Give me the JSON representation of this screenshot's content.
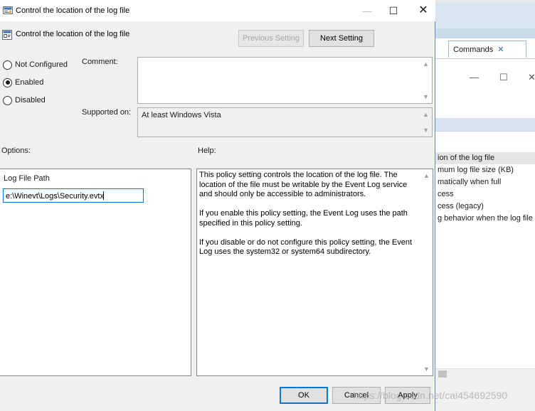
{
  "window": {
    "title": "Control the location of the log file",
    "minimize_glyph": "—",
    "maximize_glyph": "☐",
    "close_glyph": "✕"
  },
  "header": {
    "title": "Control the location of the log file",
    "previous_setting_label": "Previous Setting",
    "next_setting_label": "Next Setting"
  },
  "state_options": [
    {
      "label": "Not Configured",
      "checked": false
    },
    {
      "label": "Enabled",
      "checked": true
    },
    {
      "label": "Disabled",
      "checked": false
    }
  ],
  "comment": {
    "label": "Comment:",
    "value": ""
  },
  "supported_on": {
    "label": "Supported on:",
    "value": "At least Windows Vista"
  },
  "options": {
    "label": "Options:",
    "field_label": "Log File Path",
    "field_value": "e:\\Winevt\\Logs\\Security.evtx"
  },
  "help": {
    "label": "Help:",
    "paragraphs": [
      "This policy setting controls the location of the log file. The location of the file must be writable by the Event Log service and should only be accessible to administrators.",
      "If you enable this policy setting, the Event Log uses the path specified in this policy setting.",
      "If you disable or do not configure this policy setting, the Event Log uses the system32 or system64 subdirectory."
    ]
  },
  "footer": {
    "ok_label": "OK",
    "cancel_label": "Cancel",
    "apply_label": "Apply"
  },
  "background_window": {
    "commands_tab_label": "Commands",
    "commands_tab_close": "✕",
    "inner_min": "—",
    "inner_max": "☐",
    "inner_close": "✕",
    "list_rows": [
      "ion of the log file",
      "mum log file size (KB)",
      "matically when full",
      "cess",
      "cess (legacy)",
      "g behavior when the log file"
    ]
  },
  "watermark_text": "https://blog.csdn.net/cai454692590",
  "colors": {
    "accent": "#0078d7",
    "dialog_bg": "#f0f0f0",
    "border": "#adadad"
  }
}
